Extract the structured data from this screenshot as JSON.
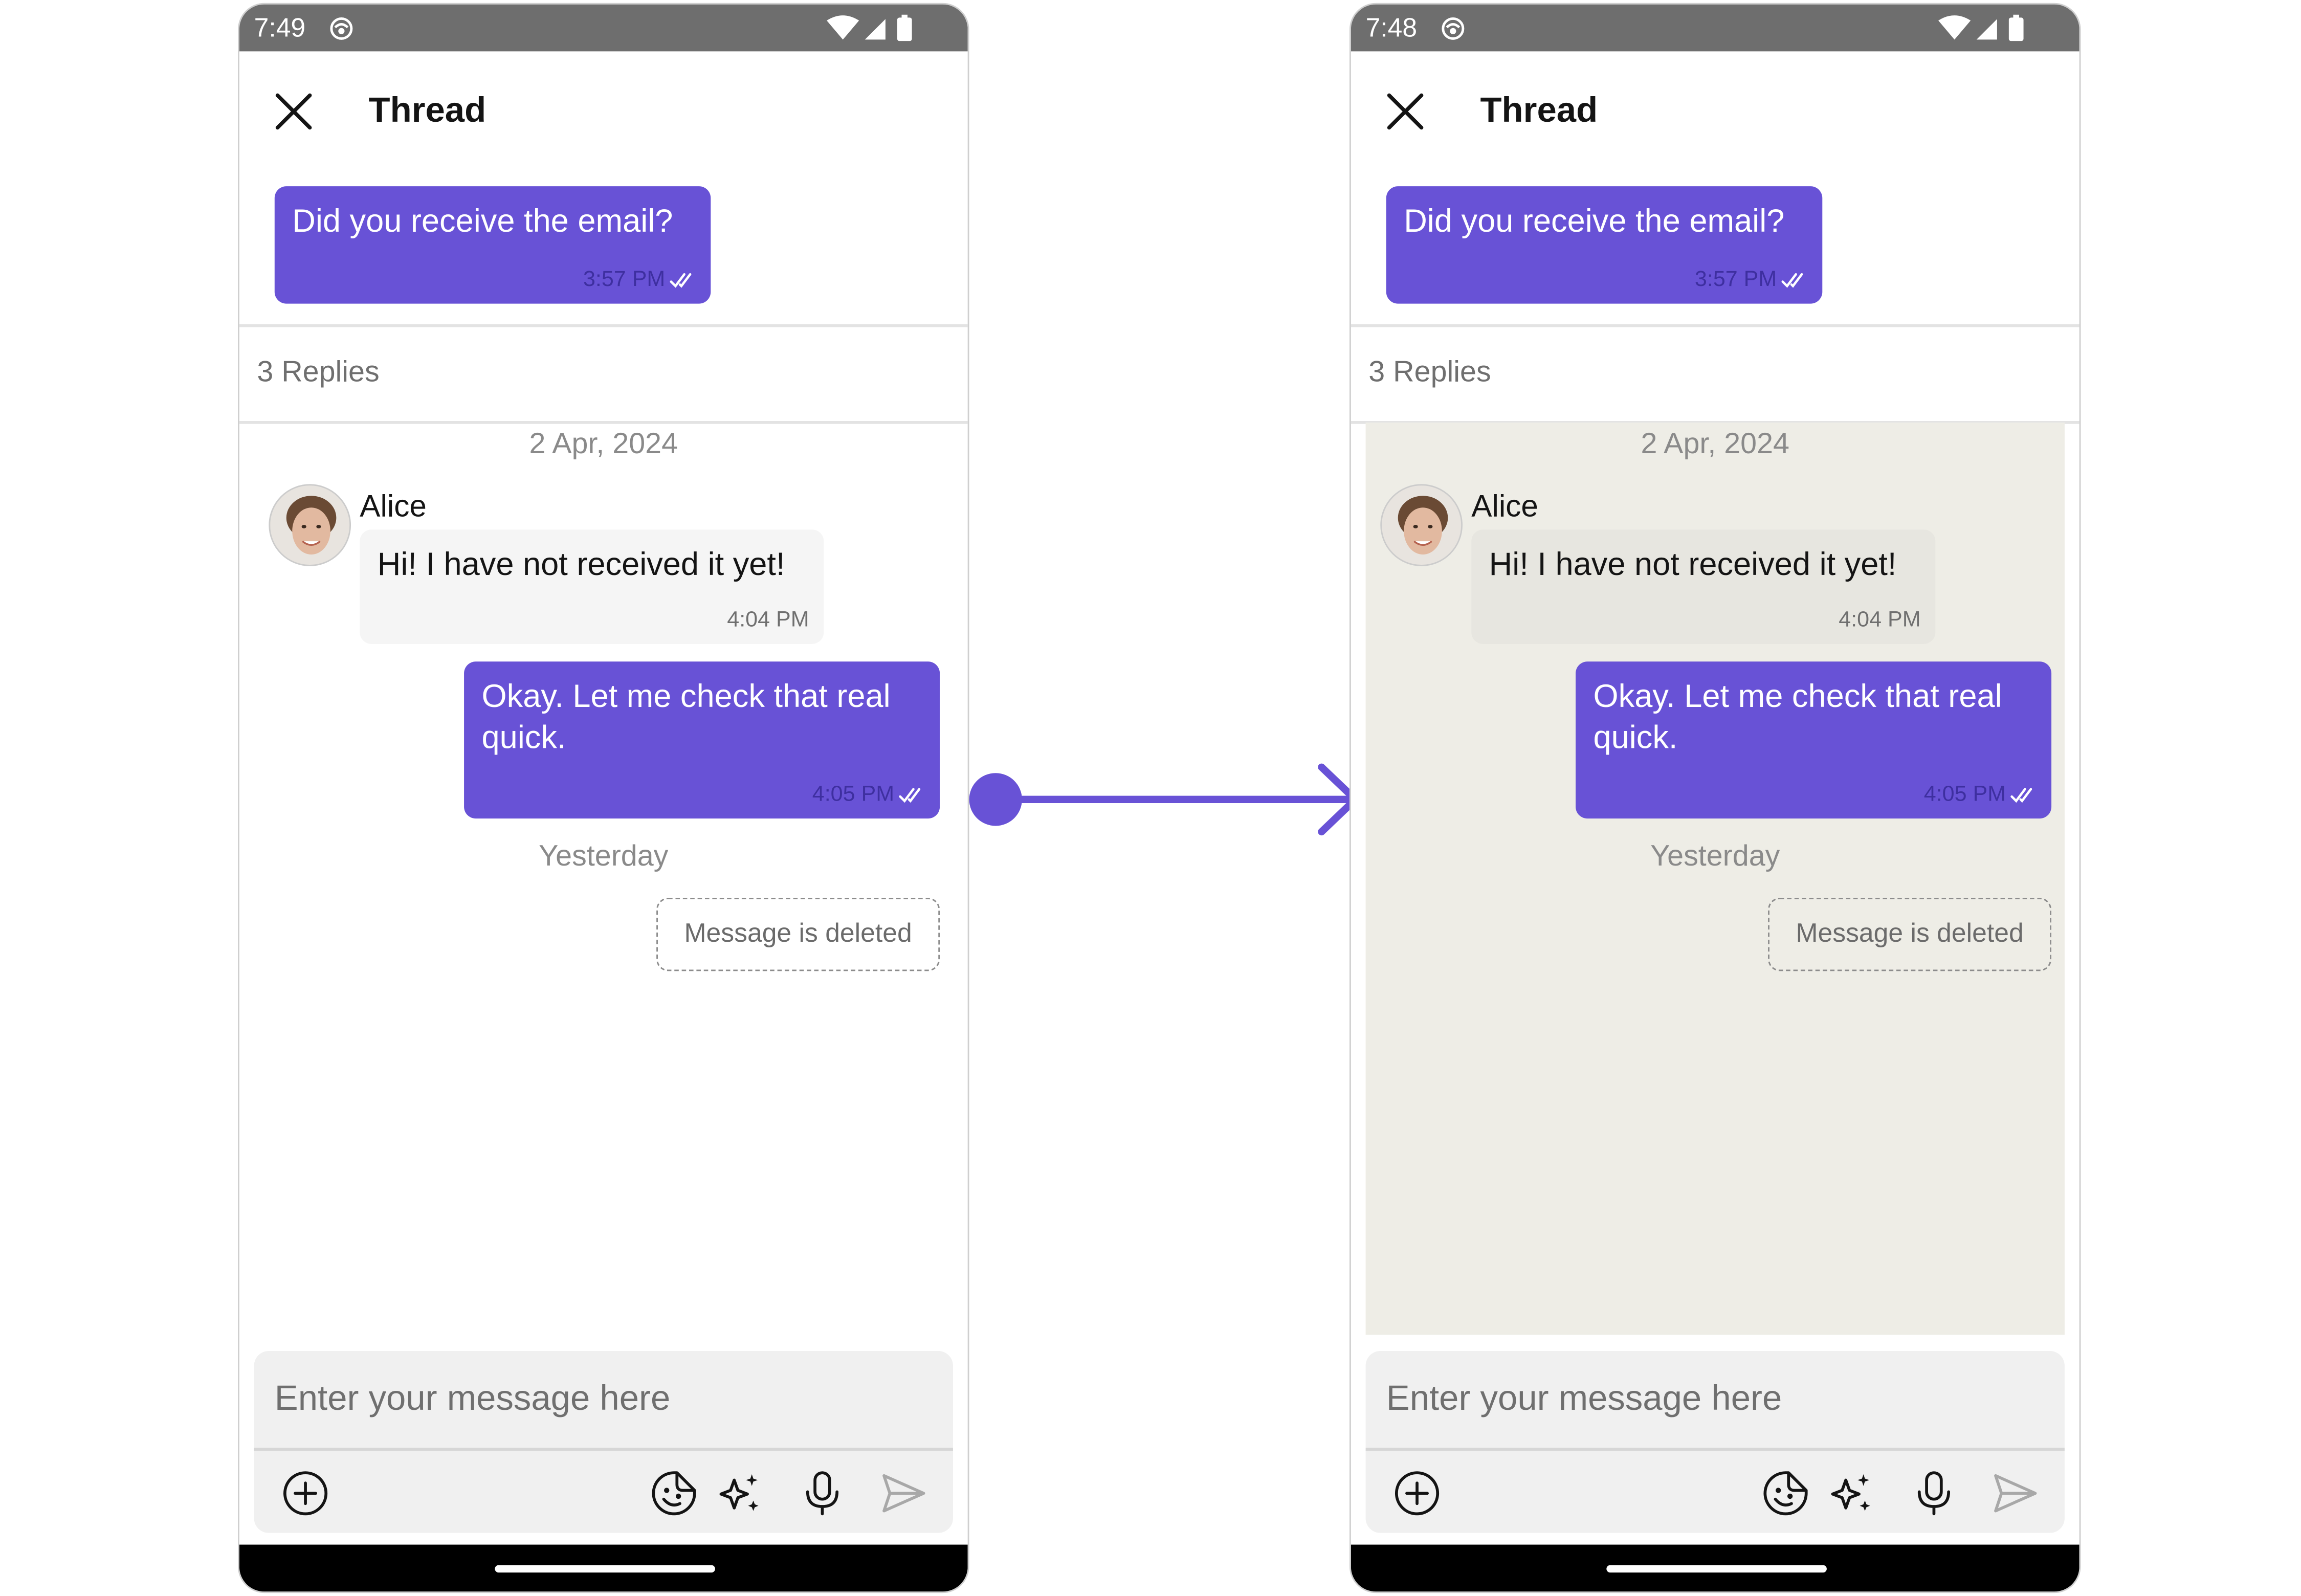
{
  "colors": {
    "accent": "#6852d6",
    "status_bar": "#6e6e6e",
    "incoming_bubble": "#f5f5f5",
    "custom_background": "#eeede6",
    "text_primary": "#141414",
    "text_secondary": "#6f6f6f"
  },
  "screens": [
    {
      "status": {
        "time": "7:49",
        "icons": [
          "app-notification-icon",
          "wifi-icon",
          "signal-icon",
          "battery-icon"
        ]
      },
      "header": {
        "title": "Thread",
        "close_icon": "close-icon"
      },
      "parent_message": {
        "text": "Did you receive the email?",
        "time": "3:57 PM",
        "receipt": "read-double-tick-icon"
      },
      "replies_label": "3 Replies",
      "messages": {
        "date_1": "2 Apr, 2024",
        "incoming": {
          "sender": "Alice",
          "text": "Hi! I have not received it yet!",
          "time": "4:04 PM"
        },
        "outgoing": {
          "text": "Okay. Let me check that real quick.",
          "time": "4:05 PM",
          "receipt": "read-double-tick-icon"
        },
        "date_2": "Yesterday",
        "deleted": "Message is deleted"
      },
      "composer": {
        "placeholder": "Enter your message here",
        "icons": [
          "add-icon",
          "sticker-icon",
          "ai-sparkle-icon",
          "microphone-icon",
          "send-icon"
        ]
      }
    },
    {
      "status": {
        "time": "7:48",
        "icons": [
          "app-notification-icon",
          "wifi-icon",
          "signal-icon",
          "battery-icon"
        ]
      },
      "header": {
        "title": "Thread",
        "close_icon": "close-icon"
      },
      "parent_message": {
        "text": "Did you receive the email?",
        "time": "3:57 PM",
        "receipt": "read-double-tick-icon"
      },
      "replies_label": "3 Replies",
      "messages": {
        "date_1": "2 Apr, 2024",
        "incoming": {
          "sender": "Alice",
          "text": "Hi! I have not received it yet!",
          "time": "4:04 PM"
        },
        "outgoing": {
          "text": "Okay. Let me check that real quick.",
          "time": "4:05 PM",
          "receipt": "read-double-tick-icon"
        },
        "date_2": "Yesterday",
        "deleted": "Message is deleted"
      },
      "composer": {
        "placeholder": "Enter your message here",
        "icons": [
          "add-icon",
          "sticker-icon",
          "ai-sparkle-icon",
          "microphone-icon",
          "send-icon"
        ]
      }
    }
  ],
  "transition_icon": "right-arrow-icon"
}
